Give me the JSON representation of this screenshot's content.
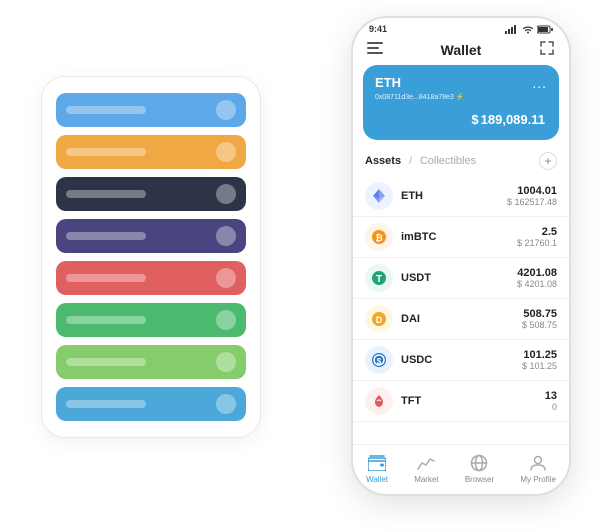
{
  "statusBar": {
    "time": "9:41",
    "signal": "●●●",
    "wifi": "wifi",
    "battery": "battery"
  },
  "navBar": {
    "menuIcon": "≡",
    "title": "Wallet",
    "expandIcon": "⤢"
  },
  "ethCard": {
    "title": "ETH",
    "dots": "...",
    "address": "0x08711d3e...8418a78e3",
    "addressSuffix": "⚡",
    "currency": "$",
    "amount": "189,089.11"
  },
  "assetsHeader": {
    "tabActive": "Assets",
    "divider": "/",
    "tabInactive": "Collectibles",
    "addIcon": "+"
  },
  "assets": [
    {
      "id": "eth",
      "name": "ETH",
      "iconType": "eth",
      "icon": "◆",
      "amount": "1004.01",
      "usd": "$ 162517.48"
    },
    {
      "id": "imbtc",
      "name": "imBTC",
      "iconType": "imbtc",
      "icon": "⊙",
      "amount": "2.5",
      "usd": "$ 21760.1"
    },
    {
      "id": "usdt",
      "name": "USDT",
      "iconType": "usdt",
      "icon": "T",
      "amount": "4201.08",
      "usd": "$ 4201.08"
    },
    {
      "id": "dai",
      "name": "DAI",
      "iconType": "dai",
      "icon": "◎",
      "amount": "508.75",
      "usd": "$ 508.75"
    },
    {
      "id": "usdc",
      "name": "USDC",
      "iconType": "usdc",
      "icon": "©",
      "amount": "101.25",
      "usd": "$ 101.25"
    },
    {
      "id": "tft",
      "name": "TFT",
      "iconType": "tft",
      "icon": "🦋",
      "amount": "13",
      "usd": "0"
    }
  ],
  "bottomNav": [
    {
      "id": "wallet",
      "label": "Wallet",
      "icon": "wallet",
      "active": true
    },
    {
      "id": "market",
      "label": "Market",
      "icon": "chart",
      "active": false
    },
    {
      "id": "browser",
      "label": "Browser",
      "icon": "globe",
      "active": false
    },
    {
      "id": "profile",
      "label": "My Profile",
      "icon": "person",
      "active": false
    }
  ],
  "cardStack": [
    {
      "id": "blue",
      "colorClass": "card-blue"
    },
    {
      "id": "orange",
      "colorClass": "card-orange"
    },
    {
      "id": "dark",
      "colorClass": "card-dark"
    },
    {
      "id": "purple",
      "colorClass": "card-purple"
    },
    {
      "id": "red",
      "colorClass": "card-red"
    },
    {
      "id": "green",
      "colorClass": "card-green"
    },
    {
      "id": "light-green",
      "colorClass": "card-light-green"
    },
    {
      "id": "light-blue",
      "colorClass": "card-light-blue"
    }
  ]
}
